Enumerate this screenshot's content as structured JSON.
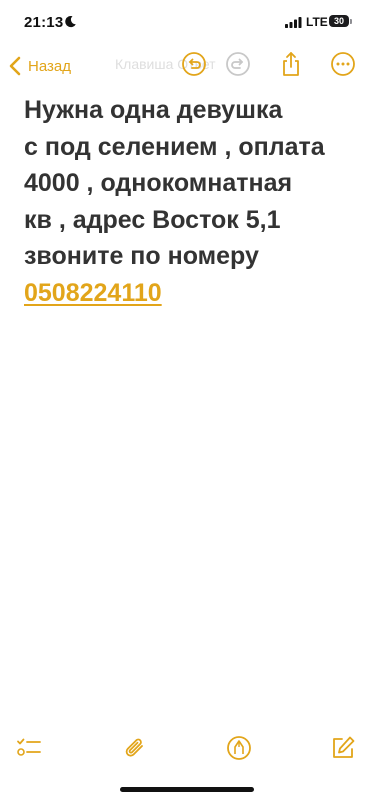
{
  "status_bar": {
    "time": "21:13",
    "network": "LTE",
    "battery_level": "30",
    "icons": [
      "moon-icon",
      "signal-icon",
      "battery-icon"
    ]
  },
  "nav": {
    "back_label": "Назад",
    "faint_title": "Клавиша Ответ",
    "icons": [
      "chevron-left-icon",
      "undo-icon",
      "redo-icon",
      "share-icon",
      "more-icon"
    ]
  },
  "note": {
    "lines": [
      "Нужна одна девушка",
      "с под селением , оплата",
      "4000 , однокомнатная",
      "кв , адрес Восток 5,1",
      "звоните по номеру"
    ],
    "phone": "0508224110"
  },
  "toolbar": {
    "icons": [
      "checklist-icon",
      "paperclip-icon",
      "markup-pen-icon",
      "compose-icon"
    ]
  },
  "colors": {
    "accent": "#e2a51a",
    "text": "#333333",
    "background": "#ffffff"
  }
}
